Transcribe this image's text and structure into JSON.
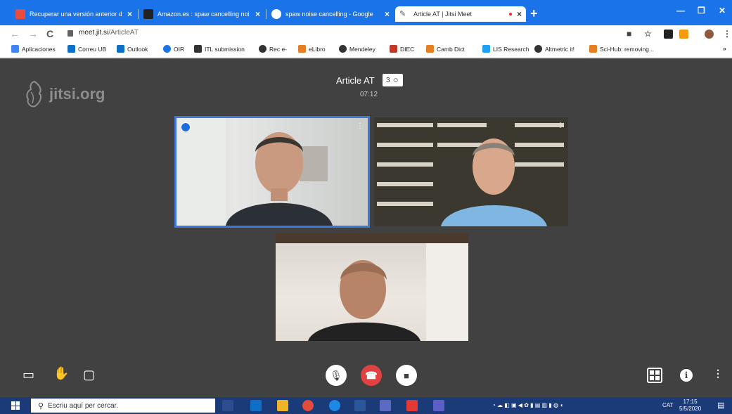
{
  "browser": {
    "tabs": [
      {
        "title": "Recuperar una versión anterior d",
        "favicon_color": "#e74c3c"
      },
      {
        "title": "Amazon.es : spaw cancelling noi",
        "favicon_color": "#222222"
      },
      {
        "title": "spaw noise cancelling - Google",
        "favicon_color": "#4285f4"
      },
      {
        "title": "Article AT | Jitsi Meet",
        "favicon_color": "#555555",
        "active": true
      }
    ],
    "new_tab_label": "+",
    "url_domain": "meet.jit.si",
    "url_path": "/ArticleAT",
    "bookmarks": [
      {
        "label": "Aplicaciones",
        "color": "#4285f4"
      },
      {
        "label": "Correu UB",
        "color": "#0f6fc6"
      },
      {
        "label": "Outlook",
        "color": "#0f6fc6"
      },
      {
        "label": "OIR",
        "color": "#1a73e8"
      },
      {
        "label": "ITL submission",
        "color": "#333333",
        "prefix": "ITL"
      },
      {
        "label": "Rec e-",
        "color": "#333333"
      },
      {
        "label": "eLibro",
        "color": "#e67e22"
      },
      {
        "label": "Mendeley",
        "color": "#333333"
      },
      {
        "label": "DIEC",
        "color": "#c0392b"
      },
      {
        "label": "Camb Dict",
        "color": "#e67e22"
      },
      {
        "label": "LIS Research",
        "color": "#1da1f2"
      },
      {
        "label": "Altmetric it!",
        "color": "#333333"
      },
      {
        "label": "Sci-Hub: removing...",
        "color": "#e67e22"
      }
    ],
    "more_bookmarks": "»"
  },
  "meeting": {
    "logo_text": "jitsi.org",
    "title": "Article AT",
    "participant_count": "3",
    "timer": "07:12"
  },
  "taskbar": {
    "search_placeholder": "Escriu aquí per cercar.",
    "language": "CAT",
    "time": "17:15",
    "date": "5/5/2020"
  },
  "colors": {
    "chrome_blue": "#1a73e8",
    "meeting_bg": "#414141",
    "active_speaker": "#3d78d8",
    "hangup": "#e04241",
    "taskbar": "#1b3a78"
  }
}
